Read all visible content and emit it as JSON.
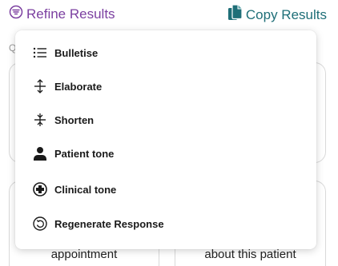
{
  "toolbar": {
    "refine_label": "Refine Results",
    "copy_label": "Copy Results"
  },
  "background": {
    "section_letter": "Q",
    "card_b_text": "appointment",
    "card_c_text": "about this patient"
  },
  "menu": {
    "items": [
      {
        "label": "Bulletise",
        "icon": "list-icon"
      },
      {
        "label": "Elaborate",
        "icon": "expand-vertical-icon"
      },
      {
        "label": "Shorten",
        "icon": "compress-vertical-icon"
      },
      {
        "label": "Patient tone",
        "icon": "person-icon"
      },
      {
        "label": "Clinical tone",
        "icon": "medical-cross-icon"
      },
      {
        "label": "Regenerate Response",
        "icon": "regenerate-icon"
      }
    ]
  },
  "colors": {
    "refine_accent": "#7b3fa0",
    "copy_accent": "#1f6f78"
  }
}
